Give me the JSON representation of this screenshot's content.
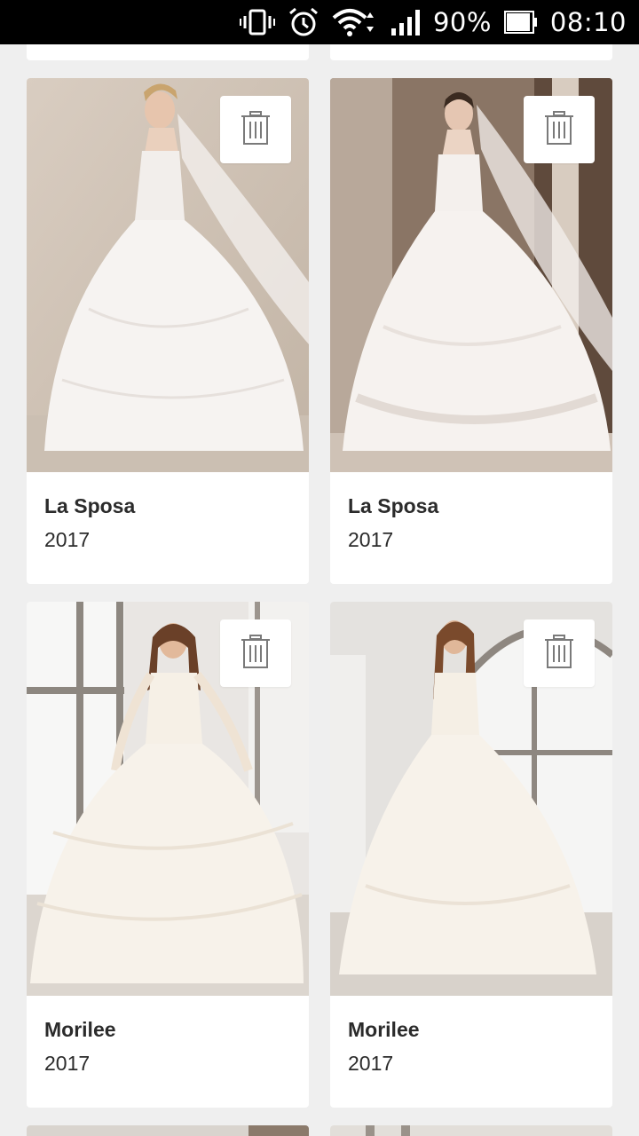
{
  "status_bar": {
    "battery_percent": "90%",
    "time": "08:10",
    "icons": [
      "vibrate-icon",
      "alarm-icon",
      "wifi-icon",
      "signal-icon",
      "battery-icon"
    ]
  },
  "favorites": [
    {
      "brand": "La Sposa",
      "year": "2017",
      "image": "ball-gown-veil-photo",
      "action": "trash-icon"
    },
    {
      "brand": "La Sposa",
      "year": "2017",
      "image": "lace-gown-veil-photo",
      "action": "trash-icon"
    },
    {
      "brand": "Morilee",
      "year": "2017",
      "image": "layered-tulle-gown-photo",
      "action": "trash-icon"
    },
    {
      "brand": "Morilee",
      "year": "2017",
      "image": "halter-gown-photo",
      "action": "trash-icon"
    }
  ],
  "colors": {
    "background": "#efefef",
    "card": "#ffffff",
    "text": "#2b2b2b",
    "icon": "#7a7a7a"
  }
}
